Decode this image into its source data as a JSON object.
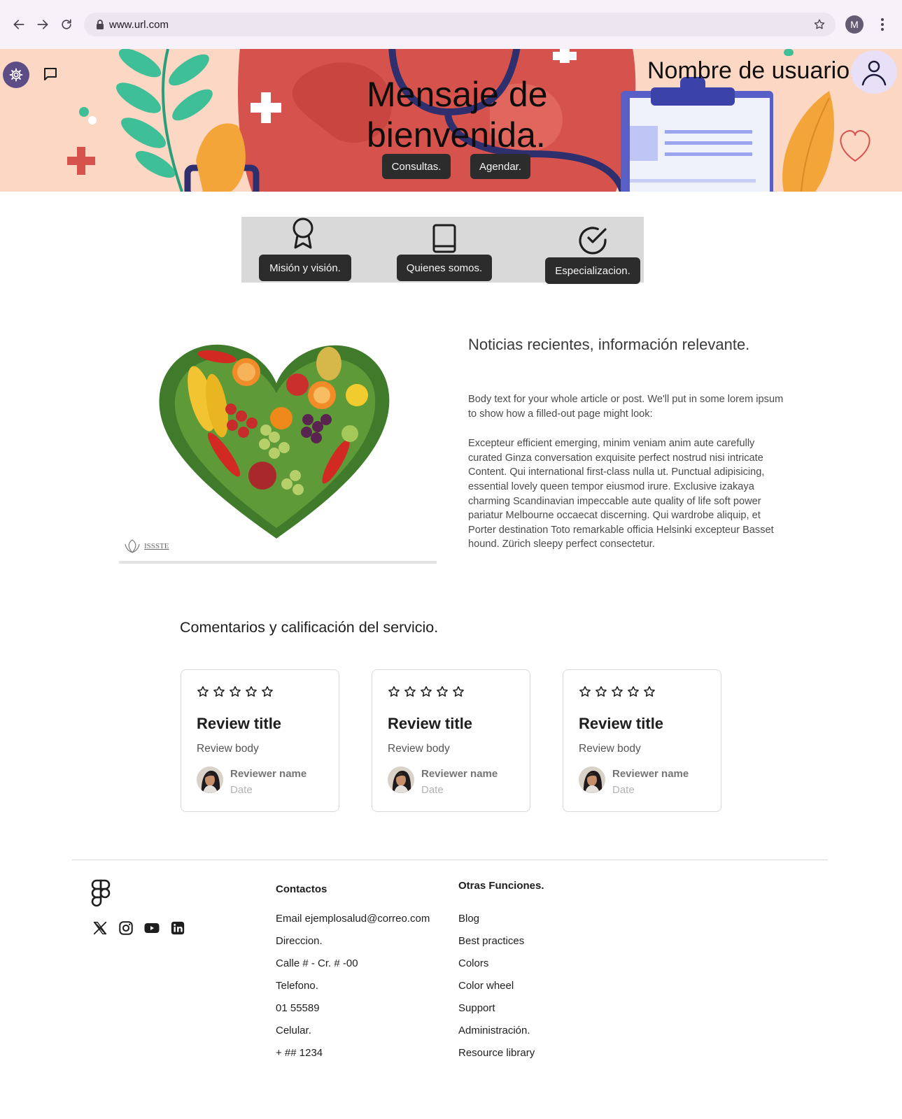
{
  "browser": {
    "url": "www.url.com",
    "profile_initial": "M"
  },
  "hero": {
    "welcome_title": "Mensaje de bienvenida.",
    "username": "Nombre de usuario.",
    "buttons": {
      "consultas": "Consultas.",
      "agendar": "Agendar."
    }
  },
  "quick_links": [
    {
      "label": "Misión y visión.",
      "icon": "award-icon"
    },
    {
      "label": "Quienes somos.",
      "icon": "book-icon"
    },
    {
      "label": "Especializacion.",
      "icon": "check-circle-icon"
    }
  ],
  "news": {
    "title": "Noticias recientes, información relevante.",
    "paragraph_1": "Body text for your whole article or post. We'll put in some lorem ipsum to show how a filled-out page might look:",
    "paragraph_2": "Excepteur efficient emerging, minim veniam anim aute carefully curated Ginza conversation exquisite perfect nostrud nisi intricate Content. Qui  international first-class nulla ut. Punctual adipisicing, essential lovely queen tempor eiusmod irure. Exclusive izakaya charming Scandinavian impeccable aute quality of life soft power pariatur Melbourne occaecat discerning. Qui wardrobe aliquip, et Porter destination Toto remarkable officia Helsinki excepteur Basset hound. Zürich sleepy perfect consectetur.",
    "image_logo_text": "ISSSTE"
  },
  "reviews": {
    "title": "Comentarios y calificación del servicio.",
    "items": [
      {
        "stars_filled": 0,
        "stars_total": 5,
        "title": "Review title",
        "body": "Review body",
        "reviewer": "Reviewer name",
        "date": "Date"
      },
      {
        "stars_filled": 0,
        "stars_total": 5,
        "title": "Review title",
        "body": "Review body",
        "reviewer": "Reviewer name",
        "date": "Date"
      },
      {
        "stars_filled": 0,
        "stars_total": 5,
        "title": "Review title",
        "body": "Review body",
        "reviewer": "Reviewer name",
        "date": "Date"
      }
    ]
  },
  "footer": {
    "socials": [
      "x-icon",
      "instagram-icon",
      "youtube-icon",
      "linkedin-icon"
    ],
    "contacts": {
      "heading": "Contactos",
      "items": [
        "Email ejemplosalud@correo.com",
        "Direccion.",
        "Calle # - Cr. # -00",
        "Telefono.",
        "01 55589",
        "Celular.",
        "+ ## 1234"
      ]
    },
    "other": {
      "heading": "Otras Funciones.",
      "items": [
        "Blog",
        "Best practices",
        "Colors",
        "Color wheel",
        "Support",
        "Administración.",
        "Resource library"
      ]
    }
  },
  "colors": {
    "hero_bg": "#fcd7c4",
    "dark_button": "#2c2c2c",
    "accent_purple": "#5c4d86",
    "browser_bar": "#f7f2fa"
  }
}
